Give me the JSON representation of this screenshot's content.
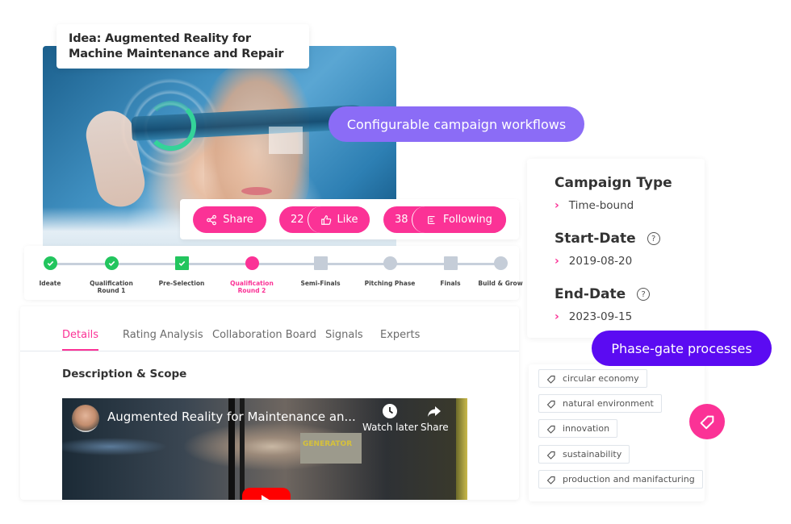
{
  "idea": {
    "title": "Idea: Augmented Reality for Machine Maintenance and Repair"
  },
  "actions": {
    "share_label": "Share",
    "like_count": "22",
    "like_label": "Like",
    "follow_count": "38",
    "follow_label": "Following"
  },
  "callouts": {
    "workflows": "Configurable campaign workflows",
    "phase_gate": "Phase-gate processes"
  },
  "stepper": {
    "steps": [
      {
        "label": "Ideate",
        "state": "done",
        "shape": "circle"
      },
      {
        "label": "Qualification Round 1",
        "state": "done",
        "shape": "circle"
      },
      {
        "label": "Pre-Selection",
        "state": "done",
        "shape": "square"
      },
      {
        "label": "Qualification Round 2",
        "state": "current",
        "shape": "circle"
      },
      {
        "label": "Semi-Finals",
        "state": "todo",
        "shape": "square"
      },
      {
        "label": "Pitching Phase",
        "state": "todo",
        "shape": "circle"
      },
      {
        "label": "Finals",
        "state": "todo",
        "shape": "square"
      },
      {
        "label": "Build & Grow",
        "state": "todo",
        "shape": "circle"
      }
    ]
  },
  "tabs": [
    {
      "label": "Details",
      "active": true
    },
    {
      "label": "Rating Analysis",
      "active": false
    },
    {
      "label": "Collaboration Board",
      "active": false
    },
    {
      "label": "Signals",
      "active": false
    },
    {
      "label": "Experts",
      "active": false
    }
  ],
  "details": {
    "section_title": "Description & Scope",
    "video": {
      "title": "Augmented Reality for Maintenance an...",
      "watch_later": "Watch later",
      "share": "Share",
      "overlay_text": "GENERATOR"
    }
  },
  "campaign": {
    "type_heading": "Campaign Type",
    "type_value": "Time-bound",
    "start_heading": "Start-Date",
    "start_value": "2019-08-20",
    "end_heading": "End-Date",
    "end_value": "2023-09-15",
    "help_glyph": "?",
    "chevron_glyph": "›"
  },
  "tags": [
    "circular economy",
    "natural environment",
    "innovation",
    "sustainability",
    "production and manifacturing"
  ],
  "colors": {
    "accent_pink": "#fb3296",
    "workflow_purple": "#8b6cf6",
    "phase_purple": "#5b0bf2",
    "done_green": "#22c55e",
    "todo_gray": "#c5cdd8"
  }
}
